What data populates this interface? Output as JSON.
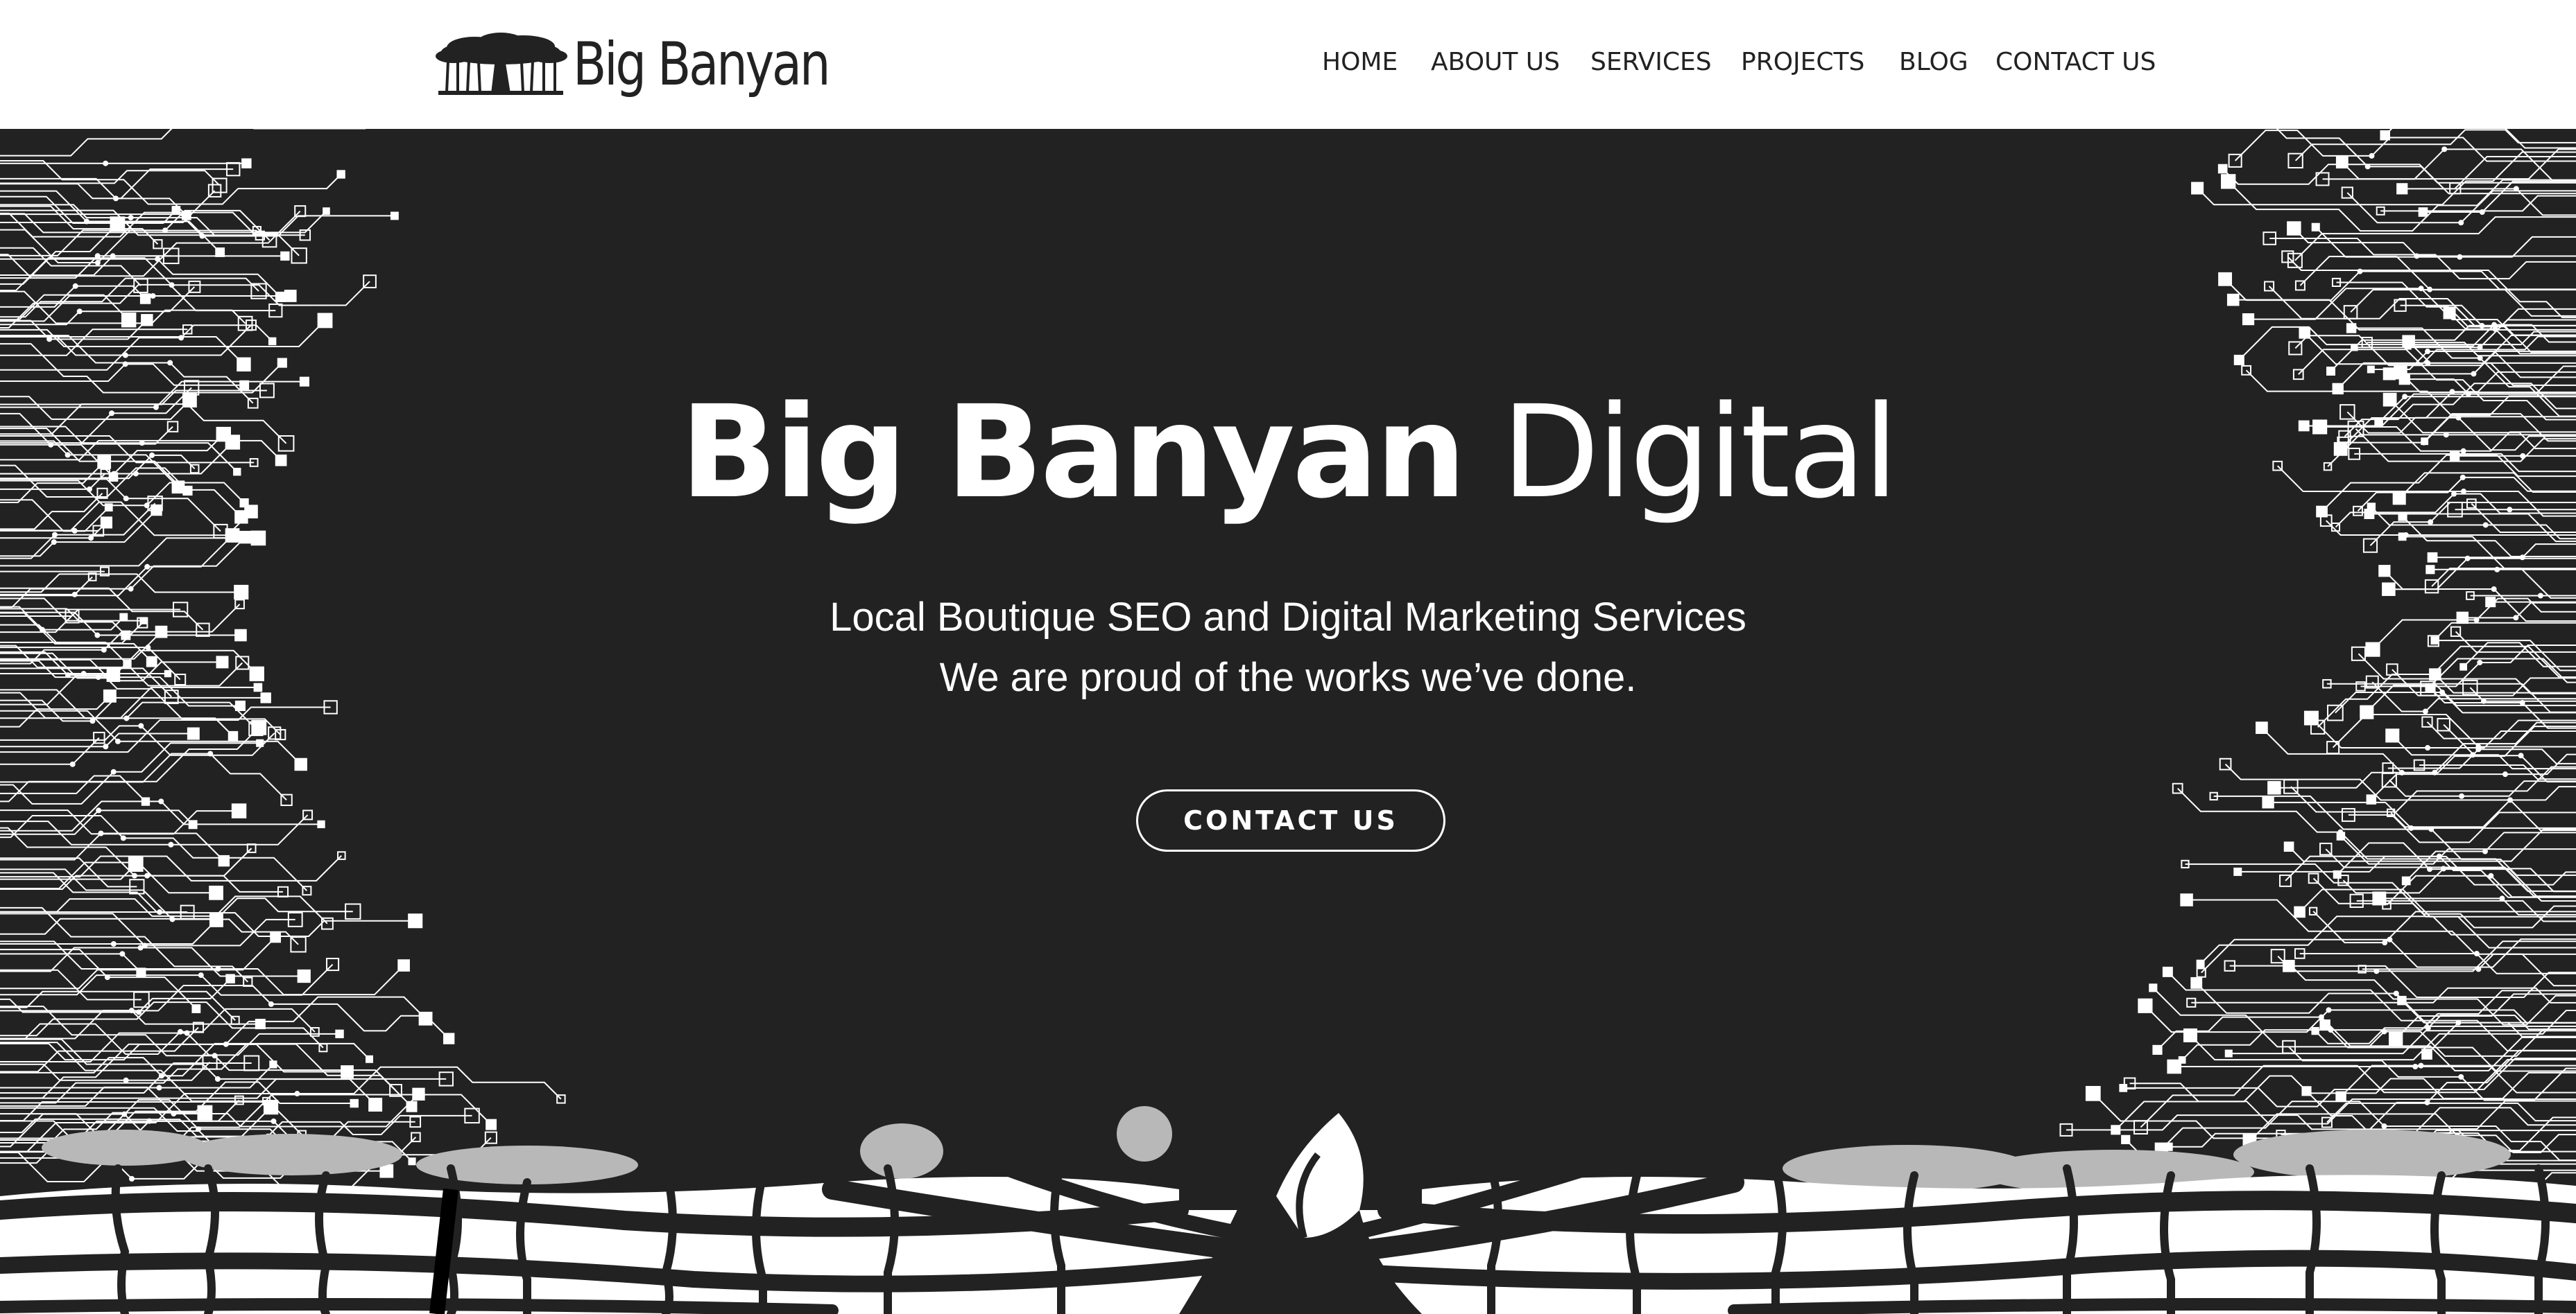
{
  "brand": {
    "name": "Big Banyan",
    "logo_icon": "banyan-tree-icon"
  },
  "nav": {
    "items": [
      {
        "label": "HOME"
      },
      {
        "label": "ABOUT US"
      },
      {
        "label": "SERVICES"
      },
      {
        "label": "PROJECTS"
      },
      {
        "label": "BLOG"
      },
      {
        "label": "CONTACT US"
      }
    ]
  },
  "hero": {
    "title_bold": "Big Banyan",
    "title_light": "Digital",
    "line1": "Local Boutique SEO and Digital Marketing Services",
    "line2": "We are proud of the works we’ve done.",
    "cta_label": "CONTACT US",
    "background_graphic": "circuit-board-tree-illustration"
  },
  "colors": {
    "hero_background": "#222222",
    "header_background": "#ffffff",
    "text_light": "#ffffff",
    "text_dark": "#222222",
    "canopy_gray": "#b8b8b8"
  }
}
